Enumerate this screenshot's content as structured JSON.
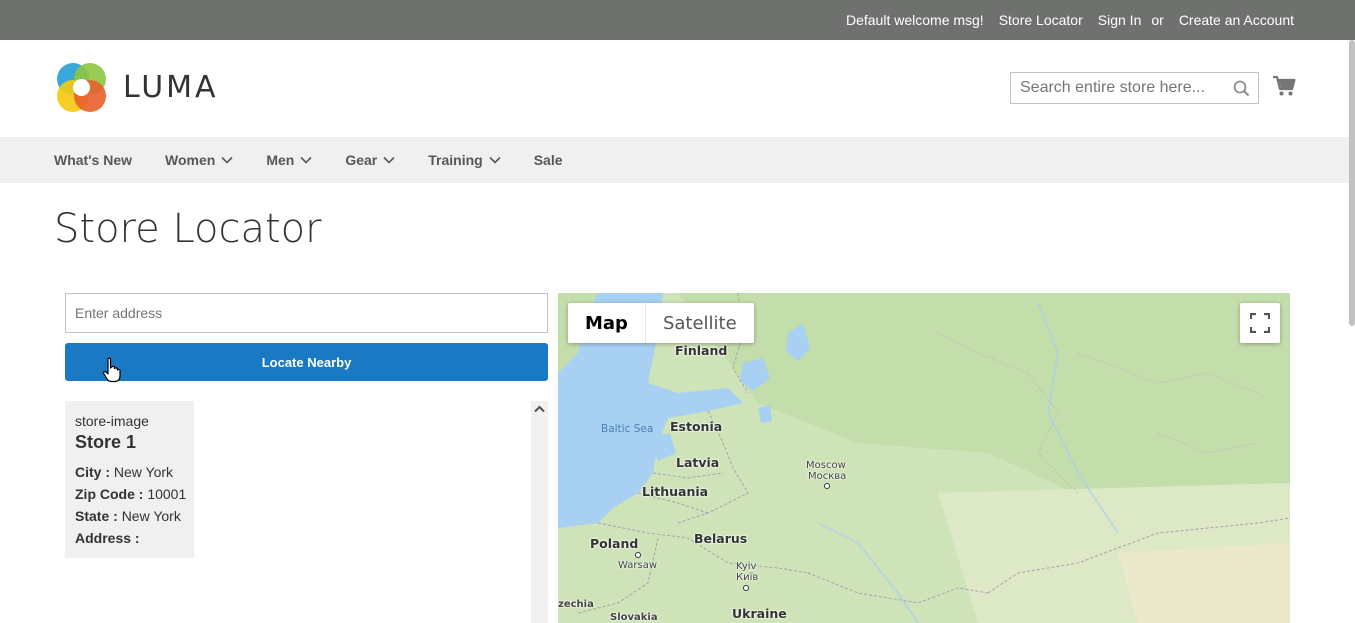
{
  "topbar": {
    "welcome": "Default welcome msg!",
    "store_locator": "Store Locator",
    "sign_in": "Sign In",
    "or": "or",
    "create_account": "Create an Account"
  },
  "header": {
    "logo_text": "LUMA",
    "search_placeholder": "Search entire store here..."
  },
  "nav": {
    "items": [
      {
        "label": "What's New",
        "dropdown": false
      },
      {
        "label": "Women",
        "dropdown": true
      },
      {
        "label": "Men",
        "dropdown": true
      },
      {
        "label": "Gear",
        "dropdown": true
      },
      {
        "label": "Training",
        "dropdown": true
      },
      {
        "label": "Sale",
        "dropdown": false
      }
    ]
  },
  "page": {
    "title": "Store Locator",
    "address_placeholder": "Enter address",
    "locate_button": "Locate Nearby"
  },
  "stores": [
    {
      "image_alt": "store-image",
      "name": "Store 1",
      "city_label": "City :",
      "city": "New York",
      "zip_label": "Zip Code :",
      "zip": "10001",
      "state_label": "State :",
      "state": "New York",
      "address_label": "Address :",
      "address": ""
    }
  ],
  "map": {
    "type_map": "Map",
    "type_satellite": "Satellite",
    "labels": {
      "finland": "Finland",
      "baltic_sea": "Baltic Sea",
      "estonia": "Estonia",
      "latvia": "Latvia",
      "lithuania": "Lithuania",
      "moscow": "Moscow",
      "moscow_local": "Москва",
      "poland": "Poland",
      "warsaw": "Warsaw",
      "belarus": "Belarus",
      "kyiv": "Kyiv",
      "kyiv_local": "Київ",
      "ukraine": "Ukraine",
      "czechia": "zechia",
      "slovakia": "Slovakia"
    }
  },
  "colors": {
    "topbar_bg": "#6e716e",
    "nav_bg": "#f0f0f0",
    "accent": "#1979c3",
    "map_land": "#d9e8c4",
    "map_water": "#a8d0f2"
  }
}
